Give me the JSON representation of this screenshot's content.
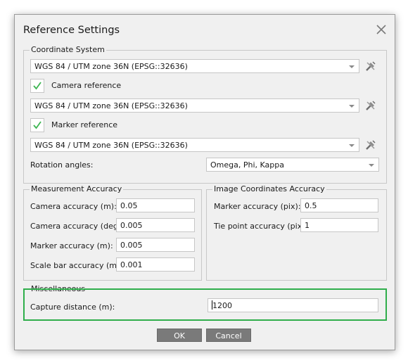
{
  "dialog": {
    "title": "Reference Settings"
  },
  "coordinate_system": {
    "title": "Coordinate System",
    "main_crs": "WGS 84 / UTM zone 36N (EPSG::32636)",
    "camera_reference_label": "Camera reference",
    "camera_reference_checked": true,
    "camera_crs": "WGS 84 / UTM zone 36N (EPSG::32636)",
    "marker_reference_label": "Marker reference",
    "marker_reference_checked": true,
    "marker_crs": "WGS 84 / UTM zone 36N (EPSG::32636)",
    "rotation_label": "Rotation angles:",
    "rotation_value": "Omega, Phi, Kappa"
  },
  "measurement_accuracy": {
    "title": "Measurement Accuracy",
    "camera_m_label": "Camera accuracy (m):",
    "camera_m_value": "0.05",
    "camera_deg_label": "Camera accuracy (deg):",
    "camera_deg_value": "0.005",
    "marker_m_label": "Marker accuracy (m):",
    "marker_m_value": "0.005",
    "scalebar_label": "Scale bar accuracy (m):",
    "scalebar_value": "0.001"
  },
  "image_accuracy": {
    "title": "Image Coordinates Accuracy",
    "marker_pix_label": "Marker accuracy (pix):",
    "marker_pix_value": "0.5",
    "tiepoint_label": "Tie point accuracy (pix):",
    "tiepoint_value": "1"
  },
  "misc": {
    "title": "Miscellaneous",
    "capture_label": "Capture distance (m):",
    "capture_value": "1200"
  },
  "buttons": {
    "ok": "OK",
    "cancel": "Cancel"
  },
  "colors": {
    "highlight": "#2fae4b",
    "checkmark": "#3db552",
    "button_bg": "#7a7a7a"
  },
  "icons": {
    "close": "close-icon",
    "crs_tool": "tools-icon",
    "check": "check-icon",
    "dropdown": "chevron-down-icon"
  }
}
